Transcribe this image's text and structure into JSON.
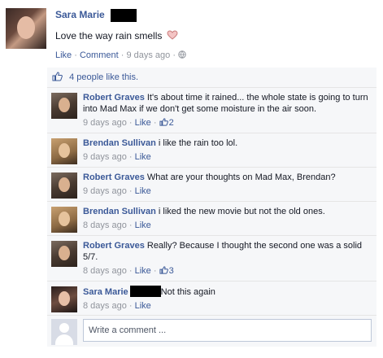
{
  "post": {
    "author": "Sara Marie",
    "text": "Love the way rain smells",
    "actions": {
      "like": "Like",
      "comment": "Comment",
      "time": "9 days ago"
    },
    "separator": "·"
  },
  "likes": {
    "text": "4 people like this."
  },
  "comments": [
    {
      "author": "Robert Graves",
      "text": "It's about time it rained... the whole state is going to turn into Mad Max if we don't get some moisture in the air soon.",
      "time": "9 days ago",
      "like": "Like",
      "like_count": "2"
    },
    {
      "author": "Brendan Sullivan",
      "text": "i like the rain too lol.",
      "time": "9 days ago",
      "like": "Like"
    },
    {
      "author": "Robert Graves",
      "text": "What are your thoughts on Mad Max, Brendan?",
      "time": "9 days ago",
      "like": "Like"
    },
    {
      "author": "Brendan Sullivan",
      "text": "i liked the new movie but not the old ones.",
      "time": "8 days ago",
      "like": "Like"
    },
    {
      "author": "Robert Graves",
      "text": "Really? Because I thought the second one was a solid 5/7.",
      "time": "8 days ago",
      "like": "Like",
      "like_count": "3"
    },
    {
      "author": "Sara Marie",
      "text": "Not this again",
      "time": "8 days ago",
      "like": "Like"
    }
  ],
  "composer": {
    "placeholder": "Write a comment ..."
  },
  "colors": {
    "link": "#3b5998",
    "meta": "#90949c",
    "ufi_bg": "#f6f7f9",
    "heart": "#e09a9a"
  }
}
